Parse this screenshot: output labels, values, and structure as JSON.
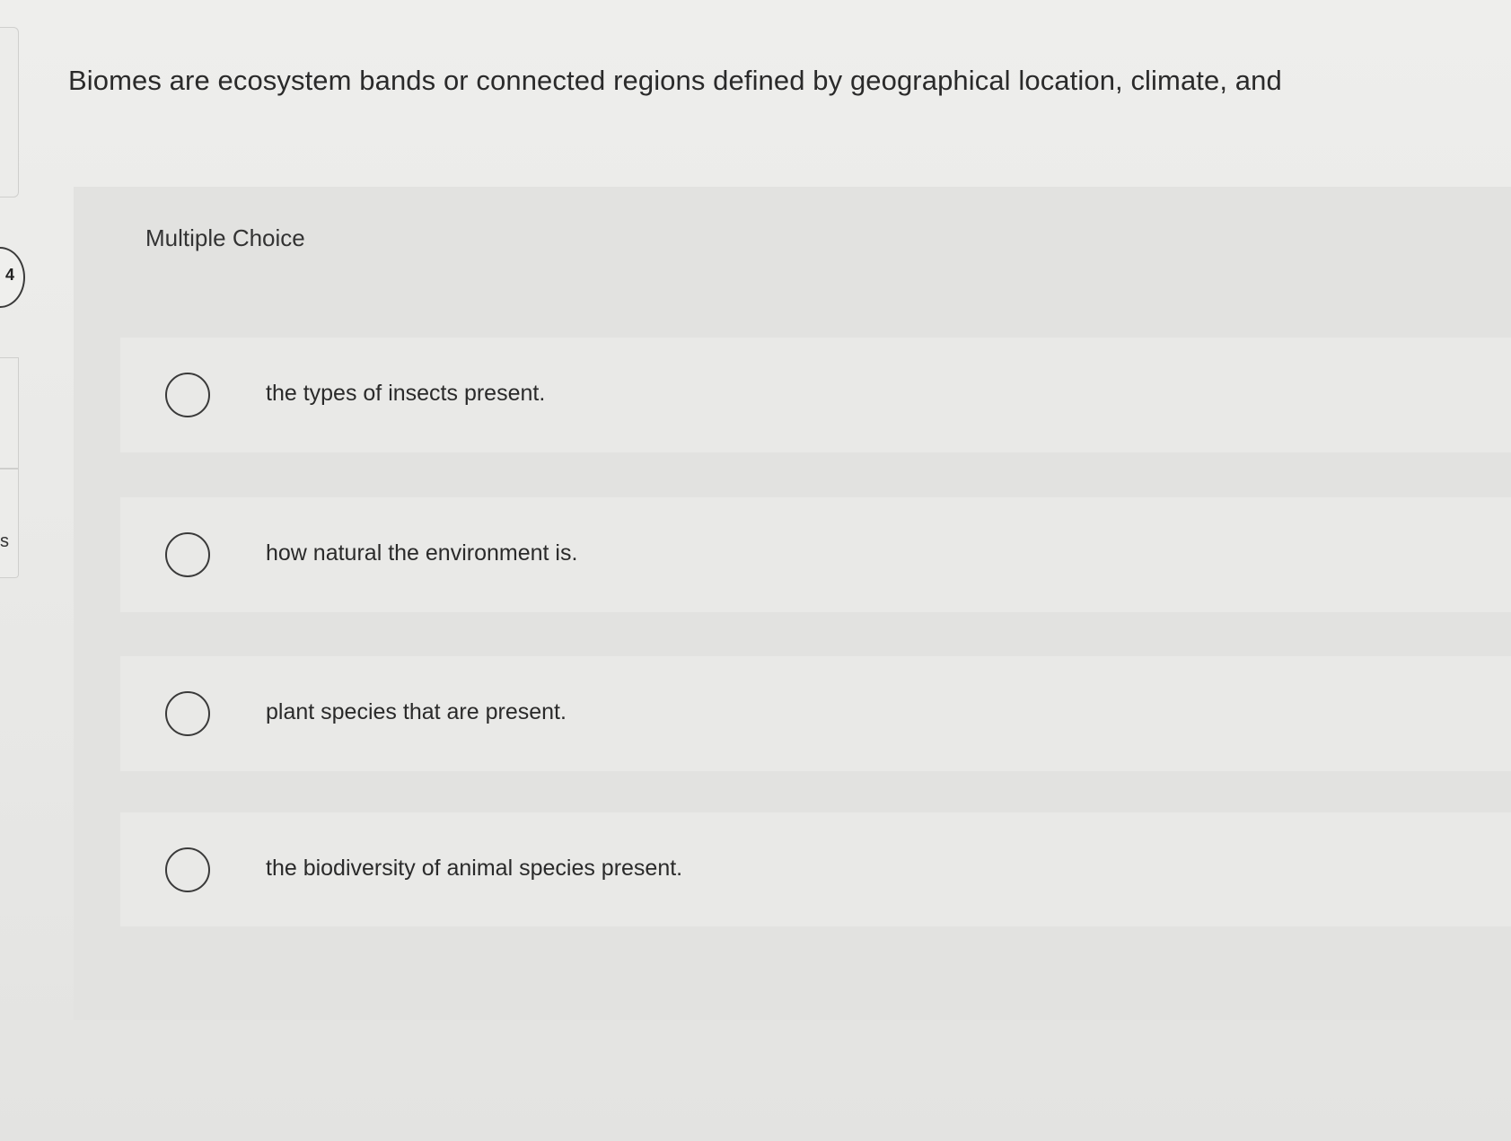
{
  "question": {
    "number": "4",
    "prompt": "Biomes are ecosystem bands or connected regions defined by geographical location, climate, and",
    "type_label": "Multiple Choice"
  },
  "sidebar": {
    "partial_letter": "s"
  },
  "options": [
    {
      "label": "the types of insects present.",
      "selected": false
    },
    {
      "label": "how natural the environment is.",
      "selected": false
    },
    {
      "label": "plant species that are present.",
      "selected": false
    },
    {
      "label": "the biodiversity of animal species present.",
      "selected": false
    }
  ]
}
